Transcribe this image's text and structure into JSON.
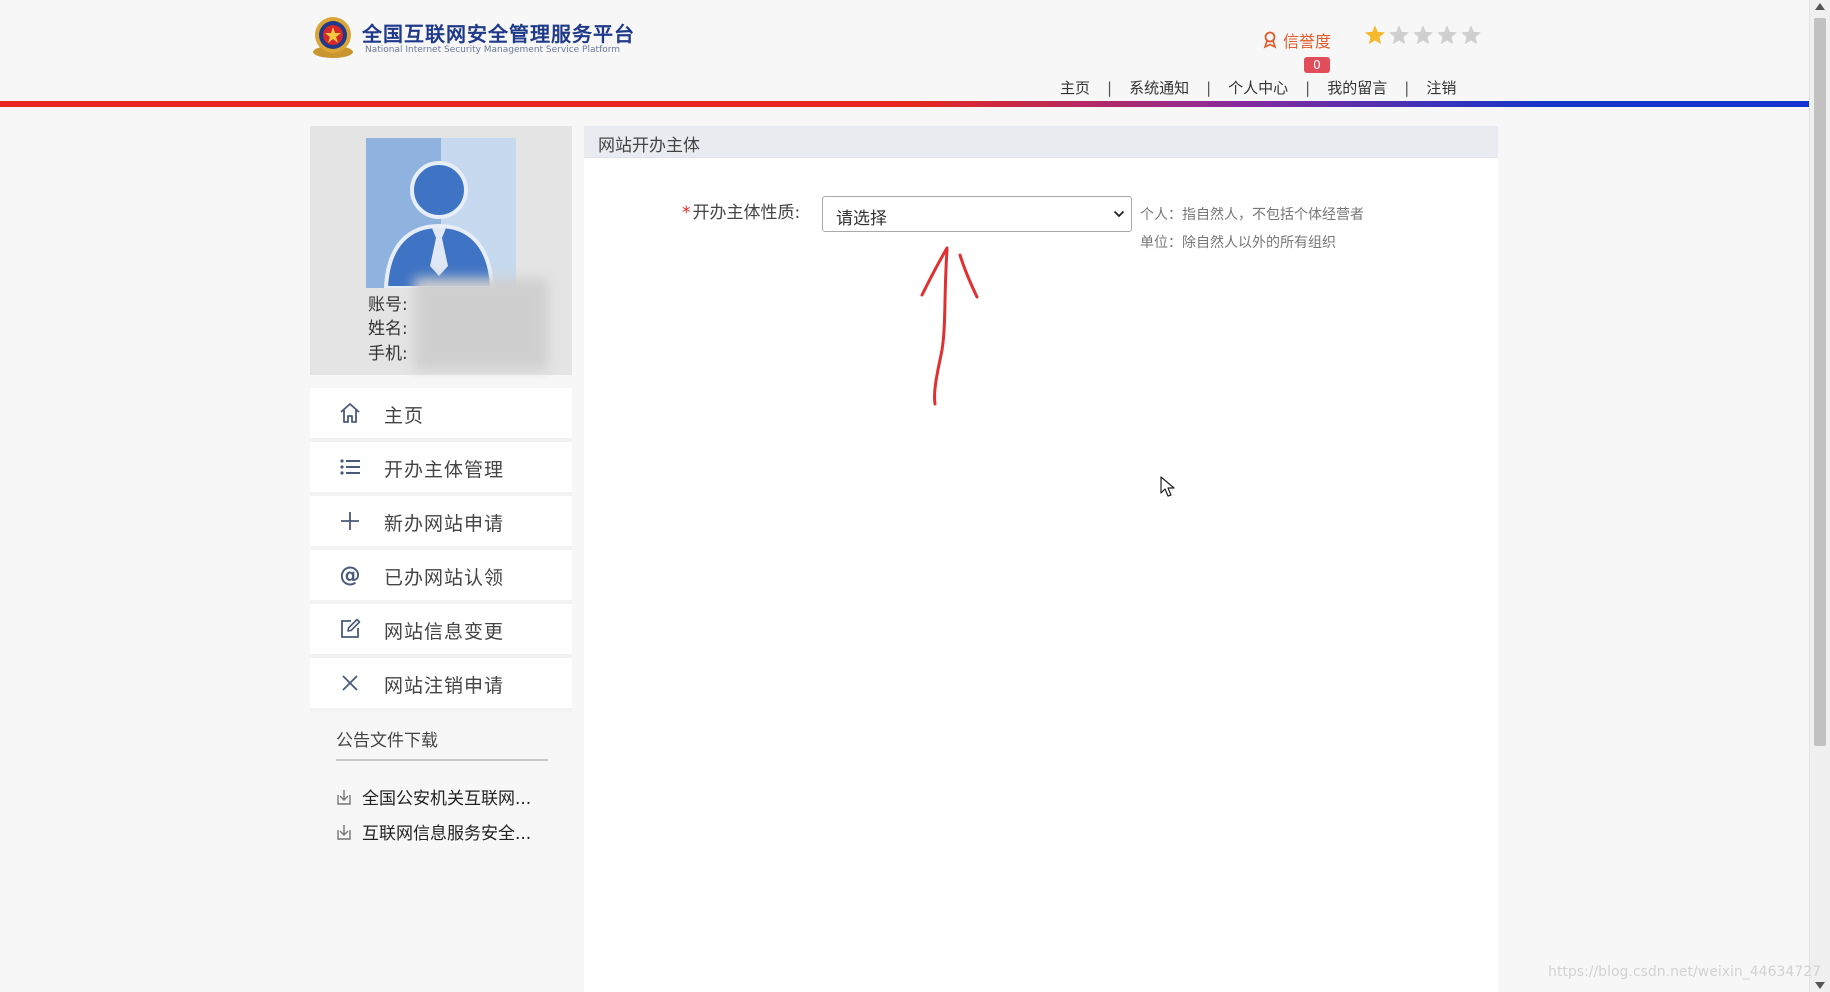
{
  "header": {
    "title": "全国互联网安全管理服务平台",
    "subtitle": "National Internet Security Management Service Platform",
    "credit_label": "信誉度",
    "credit_badge": "0",
    "credit_stars_filled": 1,
    "credit_stars_total": 5,
    "nav": [
      {
        "label": "主页"
      },
      {
        "label": "系统通知"
      },
      {
        "label": "个人中心"
      },
      {
        "label": "我的留言"
      },
      {
        "label": "注销"
      }
    ],
    "separator": "|"
  },
  "profile": {
    "account_label": "账号:",
    "name_label": "姓名:",
    "phone_label": "手机:"
  },
  "sidebar": {
    "items": [
      {
        "label": "主页",
        "icon": "home-icon"
      },
      {
        "label": "开办主体管理",
        "icon": "list-icon"
      },
      {
        "label": "新办网站申请",
        "icon": "plus-icon"
      },
      {
        "label": "已办网站认领",
        "icon": "at-icon"
      },
      {
        "label": "网站信息变更",
        "icon": "edit-icon"
      },
      {
        "label": "网站注销申请",
        "icon": "close-icon"
      }
    ]
  },
  "downloads": {
    "title": "公告文件下载",
    "items": [
      {
        "label": "全国公安机关互联网..."
      },
      {
        "label": "互联网信息服务安全..."
      }
    ]
  },
  "main": {
    "panel_title": "网站开办主体",
    "field_required_mark": "*",
    "field_label": "开办主体性质:",
    "select_value": "请选择",
    "hints": [
      "个人：指自然人，不包括个体经营者",
      "单位：除自然人以外的所有组织"
    ]
  },
  "watermark": "https://blog.csdn.net/weixin_44634727",
  "colors": {
    "brand_blue": "#1f3a8a",
    "credit_orange": "#e45b2b",
    "badge_red": "#e14d5a",
    "star_gold": "#f5b82e",
    "star_gray": "#cfcfcf",
    "annotation_red": "#e03030"
  }
}
